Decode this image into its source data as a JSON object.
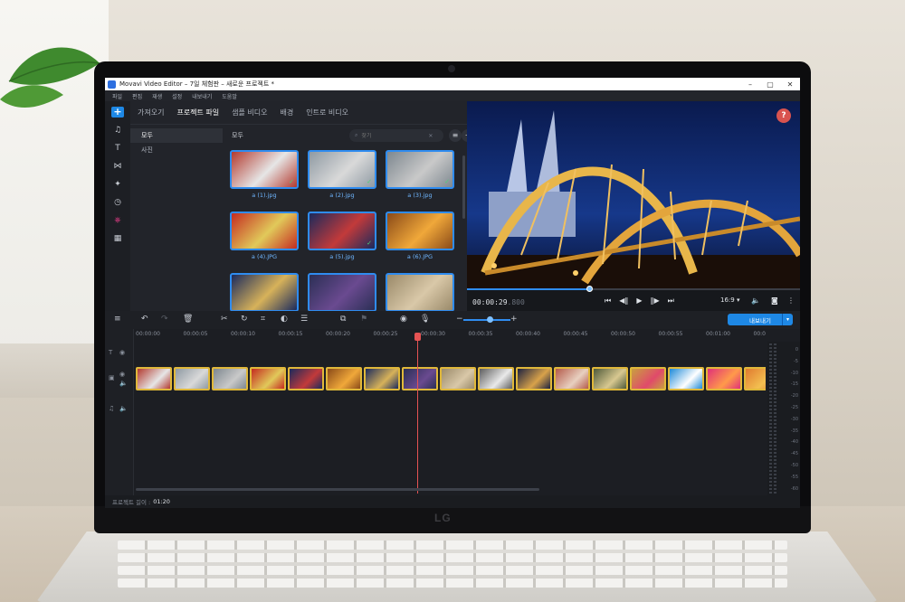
{
  "window": {
    "title": "Movavi Video Editor – 7일 체험판 – 새로운 프로젝트 *",
    "minimize": "–",
    "maximize": "▢",
    "close": "✕"
  },
  "menu": [
    "파일",
    "편집",
    "재생",
    "설정",
    "내보내기",
    "도움말"
  ],
  "tools": [
    {
      "name": "add-media",
      "glyph": "+"
    },
    {
      "name": "music",
      "glyph": "♫"
    },
    {
      "name": "titles",
      "glyph": "T"
    },
    {
      "name": "transitions",
      "glyph": "⋈"
    },
    {
      "name": "filters",
      "glyph": "✦"
    },
    {
      "name": "stickers",
      "glyph": "◷"
    },
    {
      "name": "ai-tools",
      "glyph": "⎈"
    },
    {
      "name": "more-tools",
      "glyph": "▦"
    }
  ],
  "import": {
    "tabs": [
      "가져오기",
      "프로젝트 파일",
      "샘플 비디오",
      "배경",
      "인트로 비디오"
    ],
    "active_tab": 1,
    "categories": [
      "모두",
      "사진"
    ],
    "grid_header": "모두",
    "search_placeholder": "찾기",
    "files": [
      {
        "label": "a (1).jpg",
        "checked": true,
        "colors": [
          "#b33a2f",
          "#e6e6e6"
        ]
      },
      {
        "label": "a (2).jpg",
        "checked": true,
        "colors": [
          "#8f9aa3",
          "#d9d9d9"
        ]
      },
      {
        "label": "a (3).jpg",
        "checked": true,
        "colors": [
          "#7e8890",
          "#c9c9c9"
        ]
      },
      {
        "label": "a (4).JPG",
        "checked": false,
        "colors": [
          "#c42b20",
          "#e1c95a"
        ]
      },
      {
        "label": "a (5).jpg",
        "checked": true,
        "colors": [
          "#1b2a5c",
          "#c23a3a"
        ]
      },
      {
        "label": "a (6).JPG",
        "checked": false,
        "colors": [
          "#8a4a18",
          "#f0a83a"
        ]
      },
      {
        "label": "",
        "checked": false,
        "colors": [
          "#1b2a5c",
          "#d7b25a"
        ]
      },
      {
        "label": "",
        "checked": false,
        "colors": [
          "#2b2f55",
          "#6a4a90"
        ]
      },
      {
        "label": "",
        "checked": false,
        "colors": [
          "#9a8a6a",
          "#d9c8a8"
        ]
      }
    ]
  },
  "player": {
    "time": "00:00:29",
    "time_ms": ".800",
    "progress": 0.37,
    "aspect": "16:9",
    "help": "?",
    "colors": {
      "sky": "#10286e",
      "bridge": "#e8b64a",
      "cathedral": "#aab8d8"
    }
  },
  "toolbar": {
    "export_label": "내보내기",
    "zoom_level": 0.55
  },
  "timeline": {
    "ruler": [
      "00:00:00",
      "00:00:05",
      "00:00:10",
      "00:00:15",
      "00:00:20",
      "00:00:25",
      "00:00:30",
      "00:00:35",
      "00:00:40",
      "00:00:45",
      "00:00:50",
      "00:00:55",
      "00:01:00",
      "00:0"
    ],
    "clip_colors": [
      [
        "#b33a2f",
        "#e6e6e6"
      ],
      [
        "#8f9aa3",
        "#d9d9d9"
      ],
      [
        "#7e8890",
        "#c9c9c9"
      ],
      [
        "#c42b20",
        "#e1c95a"
      ],
      [
        "#1b2a5c",
        "#c23a3a"
      ],
      [
        "#8a4a18",
        "#f0a83a"
      ],
      [
        "#1b2a5c",
        "#d7b25a"
      ],
      [
        "#2b2f55",
        "#6a4a90"
      ],
      [
        "#9a8a6a",
        "#d9c8a8"
      ],
      [
        "#5e5e5e",
        "#e9e9e9"
      ],
      [
        "#1d2240",
        "#d8a24a"
      ],
      [
        "#b45a4a",
        "#e8d0c0"
      ],
      [
        "#4e5a3a",
        "#d8c890"
      ],
      [
        "#c8a040",
        "#e04a6a"
      ],
      [
        "#1e8ad8",
        "#ffffff"
      ],
      [
        "#e0307a",
        "#ff9a4a"
      ],
      [
        "#e07a30",
        "#f3c050"
      ]
    ],
    "meter_labels": [
      "0",
      "-5",
      "-10",
      "-15",
      "-20",
      "-25",
      "-30",
      "-35",
      "-40",
      "-45",
      "-50",
      "-55",
      "-60"
    ]
  },
  "status": {
    "label": "프로젝트 길이 :",
    "value": "01:20"
  }
}
